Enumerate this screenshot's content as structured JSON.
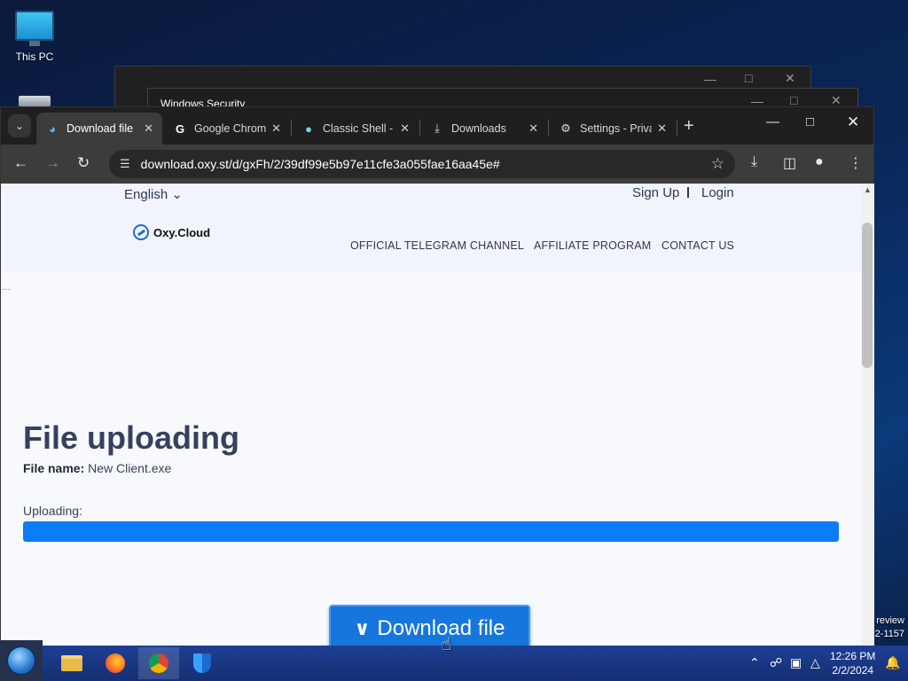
{
  "desktop": {
    "icons": [
      {
        "label": "This PC",
        "icon": "monitor-icon"
      },
      {
        "label": "",
        "icon": "drive-icon"
      }
    ],
    "edge_text": [
      "review",
      "2-1157"
    ]
  },
  "background_windows": {
    "security_title": "Windows Security"
  },
  "browser": {
    "tabs": [
      {
        "label": "Download file",
        "icon": "oxycloud-icon",
        "active": true
      },
      {
        "label": "Google Chrome",
        "icon": "google-icon",
        "active": false
      },
      {
        "label": "Classic Shell -",
        "icon": "shell-icon",
        "active": false
      },
      {
        "label": "Downloads",
        "icon": "download-icon",
        "active": false
      },
      {
        "label": "Settings - Privacy",
        "icon": "gear-icon",
        "active": false
      }
    ],
    "new_tab": "+",
    "url": "download.oxy.st/d/gxFh/2/39df99e5b97e11cfe3a055fae16aa45e#"
  },
  "site": {
    "language": "English",
    "sign_up": "Sign Up",
    "login": "Login",
    "logo_text": "Oxy.Cloud",
    "nav": [
      "OFFICIAL TELEGRAM CHANNEL",
      "AFFILIATE PROGRAM",
      "CONTACT US"
    ],
    "title": "File uploading",
    "file_name_label": "File name:",
    "file_name": "New Client.exe",
    "uploading_label": "Uploading:",
    "progress_percent": 100,
    "download_button": "Download file",
    "progress_color": "#0a7cf5",
    "button_color": "#1576de"
  },
  "taskbar": {
    "apps": [
      "explorer-icon",
      "firefox-icon",
      "chrome-icon",
      "defender-icon"
    ],
    "time": "12:26 PM",
    "date": "2/2/2024"
  }
}
